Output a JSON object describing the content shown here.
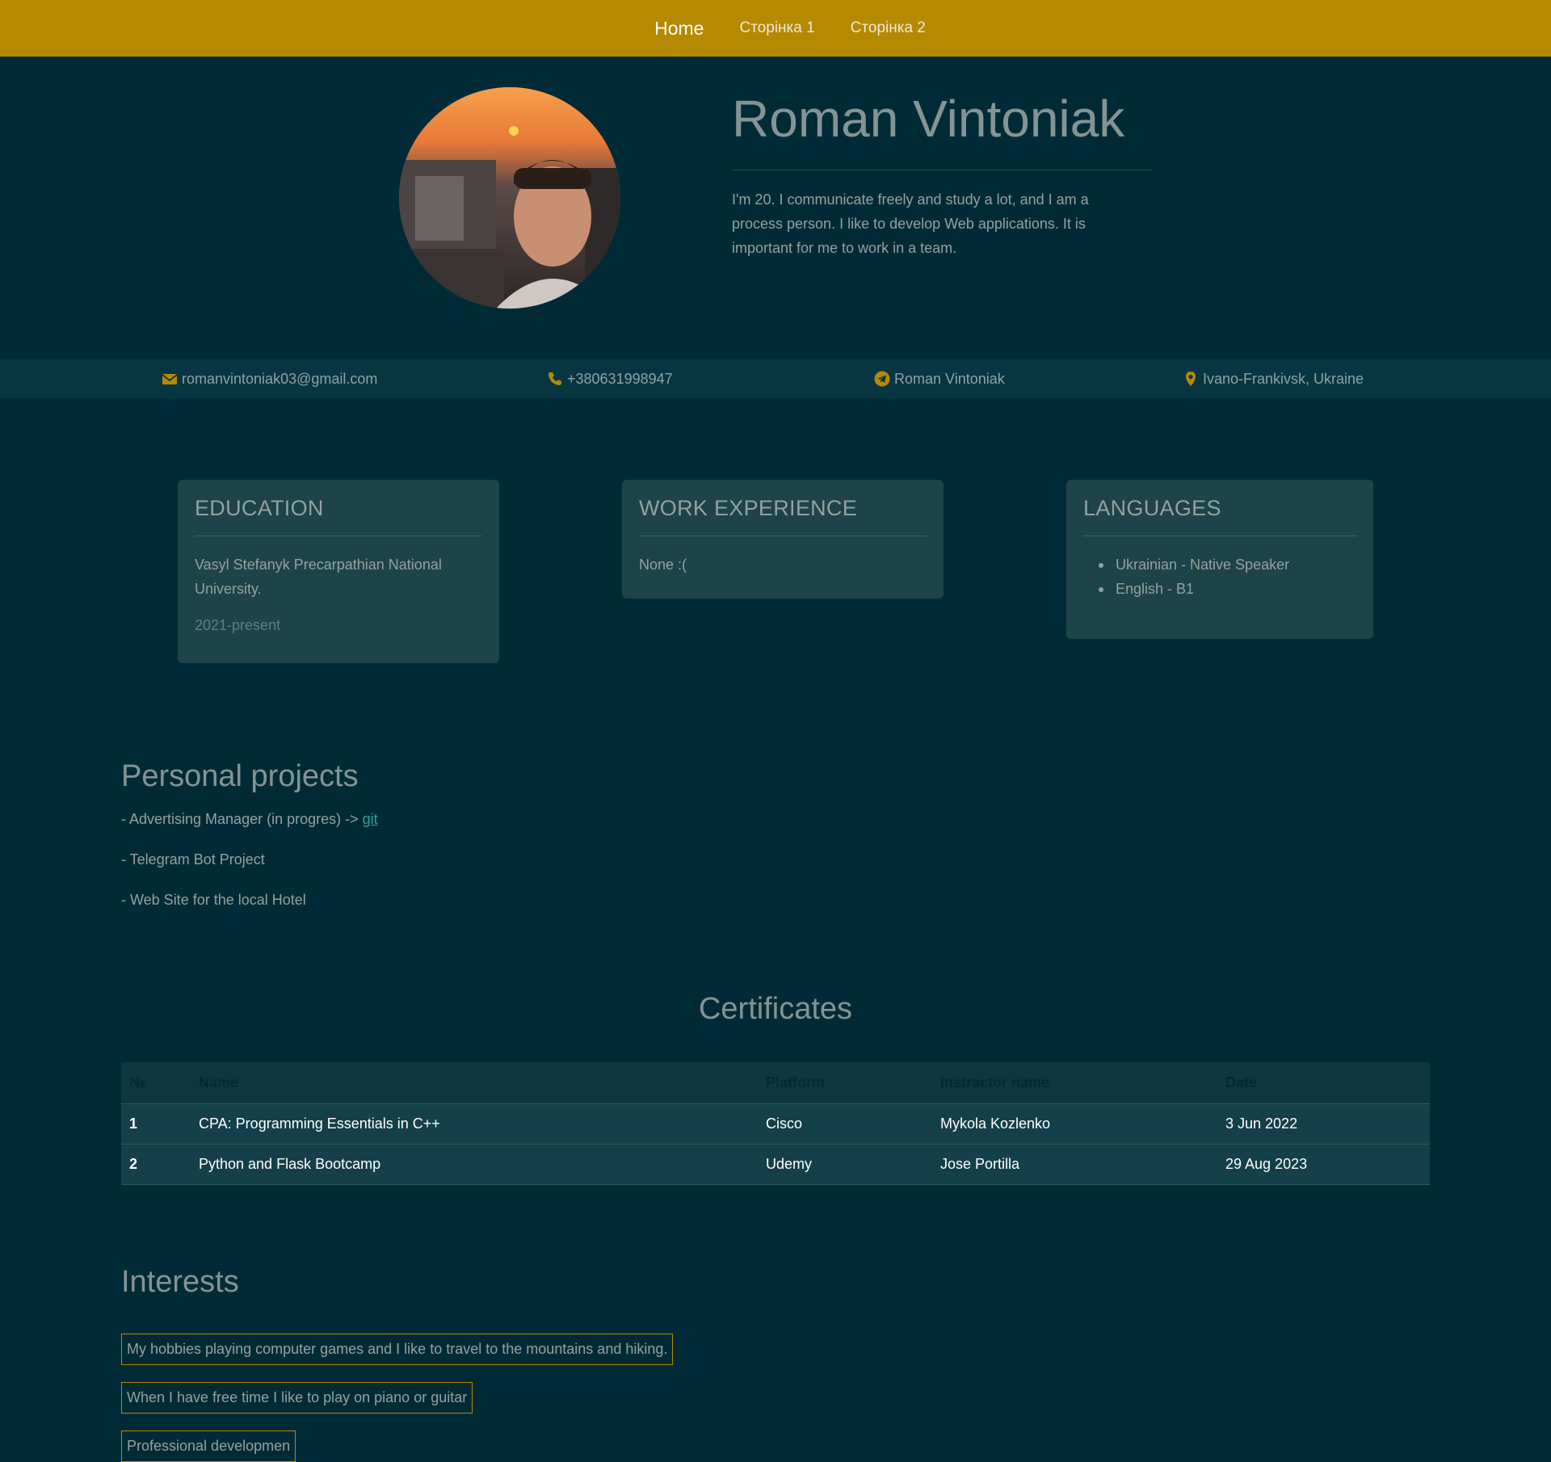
{
  "nav": {
    "items": [
      {
        "label": "Home"
      },
      {
        "label": "Сторінка 1"
      },
      {
        "label": "Сторінка 2"
      }
    ]
  },
  "hero": {
    "name": "Roman Vintoniak",
    "bio": "I'm 20. I communicate freely and study a lot, and I am a process person. I like to develop Web applications. It is important for me to work in a team."
  },
  "contacts": {
    "email": "romanvintoniak03@gmail.com",
    "phone": "+380631998947",
    "telegram": "Roman Vintoniak",
    "location": "Ivano-Frankivsk, Ukraine"
  },
  "education": {
    "title": "EDUCATION",
    "university": "Vasyl Stefanyk Precarpathian National University.",
    "years": "2021-present"
  },
  "work": {
    "title": "WORK EXPERIENCE",
    "text": "None :("
  },
  "languages": {
    "title": "LANGUAGES",
    "items": [
      "Ukrainian - Native Speaker",
      "English - B1"
    ]
  },
  "projects": {
    "title": "Personal projects",
    "items": [
      {
        "text": "- Advertising Manager (in progres) -> ",
        "link": "git"
      },
      {
        "text": "- Telegram Bot Project"
      },
      {
        "text": "- Web Site for the local Hotel"
      }
    ]
  },
  "certificates": {
    "title": "Certificates",
    "headers": [
      "№",
      "Name",
      "Platform",
      "Instractor name",
      "Date"
    ],
    "rows": [
      [
        "1",
        "CPA: Programming Essentials in C++",
        "Cisco",
        "Mykola Kozlenko",
        "3 Jun 2022"
      ],
      [
        "2",
        "Python and Flask Bootcamp",
        "Udemy",
        "Jose Portilla",
        "29 Aug 2023"
      ]
    ]
  },
  "interests": {
    "title": "Interests",
    "items": [
      "My hobbies playing computer games and I like to travel to the mountains and hiking.",
      "When I have free time I like to play on piano or guitar",
      "Professional developmen"
    ]
  },
  "colors": {
    "background": "#002b36",
    "navbar": "#b58900",
    "card": "#1e434a",
    "accent_link": "#2aa198"
  },
  "icons": [
    "envelope-icon",
    "phone-icon",
    "telegram-icon",
    "map-pin-icon"
  ]
}
